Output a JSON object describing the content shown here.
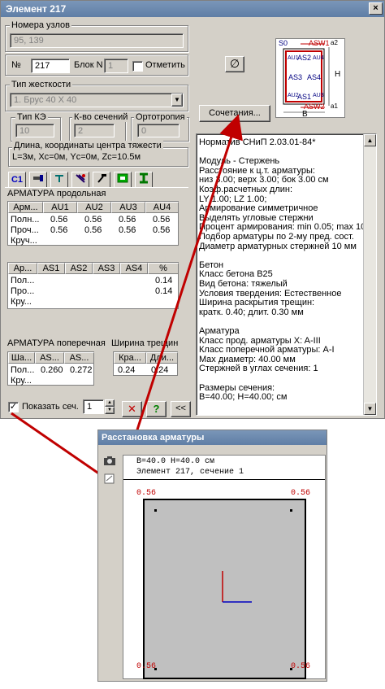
{
  "window": {
    "title": "Элемент 217",
    "close_label": "×"
  },
  "nodes": {
    "label": "Номера узлов",
    "value": "95, 139"
  },
  "number": {
    "label": "№",
    "value": "217",
    "block_label": "Блок N",
    "block_value": "1",
    "mark_label": "Отметить"
  },
  "stiffness": {
    "label": "Тип жесткости",
    "value": "1. Брус 40 X 40"
  },
  "fe_type": {
    "label": "Тип КЭ",
    "value": "10"
  },
  "sections": {
    "label": "К-во сечений",
    "value": "2"
  },
  "orthotropy": {
    "label": "Ортотропия",
    "value": "0"
  },
  "length": {
    "label": "Длина, координаты центра тяжести",
    "value": "L=3м, Xc=0м, Yc=0м, Zc=10.5м"
  },
  "tabs": [
    {
      "label": "C1"
    },
    {
      "label": ""
    },
    {
      "label": ""
    },
    {
      "label": ""
    },
    {
      "label": ""
    },
    {
      "label": ""
    },
    {
      "label": ""
    }
  ],
  "long_rebar": {
    "label": "АРМАТУРА продольная",
    "headers": [
      "Арм...",
      "AU1",
      "AU2",
      "AU3",
      "AU4"
    ],
    "rows": [
      [
        "Полн...",
        "0.56",
        "0.56",
        "0.56",
        "0.56"
      ],
      [
        "Проч...",
        "0.56",
        "0.56",
        "0.56",
        "0.56"
      ],
      [
        "Круч...",
        "",
        "",
        "",
        ""
      ]
    ]
  },
  "as_table": {
    "headers": [
      "Ар...",
      "AS1",
      "AS2",
      "AS3",
      "AS4",
      "%"
    ],
    "rows": [
      [
        "Пол...",
        "",
        "",
        "",
        "",
        "0.14"
      ],
      [
        "Про...",
        "",
        "",
        "",
        "",
        "0.14"
      ],
      [
        "Кру...",
        "",
        "",
        "",
        "",
        ""
      ]
    ]
  },
  "trans_rebar": {
    "label": "АРМАТУРА поперечная",
    "headers": [
      "Ша...",
      "AS...",
      "AS..."
    ],
    "rows": [
      [
        "Пол...",
        "0.260",
        "0.272"
      ],
      [
        "Кру...",
        "",
        ""
      ]
    ]
  },
  "crack": {
    "label": "Ширина трещин",
    "headers": [
      "Кра...",
      "Дли..."
    ],
    "rows": [
      [
        "0.24",
        "0.24"
      ]
    ]
  },
  "bottom": {
    "show_label": "Показать сеч.",
    "show_checked": "✓",
    "section_value": "1",
    "cancel_label": "✕",
    "help_label": "?",
    "collapse_label": "<<"
  },
  "diameter_label": "∅",
  "combinations_label": "Сочетания...",
  "section_diagram": {
    "s0": "S0",
    "asw1": "ASW1",
    "asw2": "ASW2",
    "a2": "a2",
    "a1": "a1",
    "H": "H",
    "B": "B",
    "au1": "AU1",
    "as2": "AS2",
    "au4": "AU4",
    "as3": "AS3",
    "as4": "AS4",
    "au2": "AU2",
    "as1": "AS1",
    "au3": "AU3"
  },
  "norms": [
    "Норматив СНиП 2.03.01-84*",
    "",
    "Модуль - Стержень",
    "Расстояние к ц.т. арматуры:",
    " низ 3.00; верх 3.00; бок 3.00 см",
    "Коэф.расчетных длин:",
    " LY 1.00; LZ 1.00;",
    "Армирование симметричное",
    "Выделять угловые стержни",
    "Процент армирования: min 0.05; max 10.00",
    "Подбор арматуры по 2-му пред. сост.",
    "Диаметр арматурных стержней 10 мм",
    "",
    "Бетон",
    "Класс бетона B25",
    "Вид бетона: тяжелый",
    "Условия твердения: Естественное",
    "Ширина раскрытия трещин:",
    " кратк. 0.40; длит. 0.30 мм",
    "",
    "Арматура",
    "Класс прод. арматуры X: A-III",
    "Класс поперечной арматуры: A-I",
    "Max диаметр: 40.00 мм",
    "Стержней в углах сечения: 1",
    "",
    "Размеры сечения:",
    "B=40.00; H=40.00;  см"
  ],
  "placement": {
    "title": "Расстановка арматуры",
    "line1": "B=40.0 H=40.0 см",
    "line2": "Элемент 217, сечение 1",
    "tl": "0.56",
    "tr": "0.56",
    "bl": "0.56",
    "br": "0.56"
  }
}
